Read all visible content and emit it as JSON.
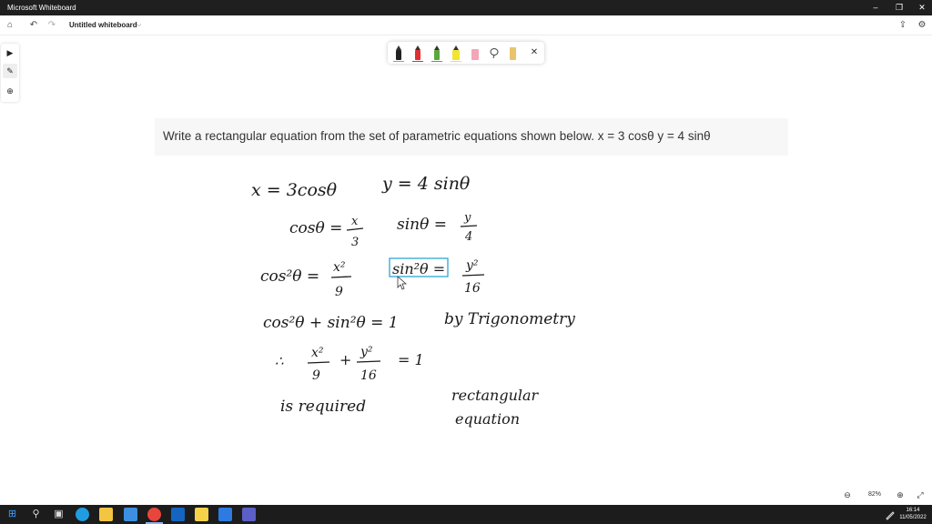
{
  "window": {
    "title": "Microsoft Whiteboard",
    "controls": [
      "–",
      "❐",
      "✕"
    ]
  },
  "appbar": {
    "document_title": "Untitled whiteboard",
    "chevron": "⌵"
  },
  "rail": {
    "tools": [
      "select-tool",
      "ink-tool",
      "add-tool"
    ]
  },
  "pen_toolbar": {
    "pens": [
      {
        "name": "black-pen",
        "color": "#222222"
      },
      {
        "name": "red-pen",
        "color": "#e03030"
      },
      {
        "name": "green-pen",
        "color": "#5aa83a"
      },
      {
        "name": "yellow-highlighter",
        "color": "#f2e531"
      },
      {
        "name": "pink-highlighter",
        "color": "#f2a6b6"
      }
    ],
    "close": "✕"
  },
  "question": {
    "text": "Write a rectangular equation from the set of parametric equations shown below. x = 3 cosθ y = 4 sinθ"
  },
  "handwriting": {
    "line1_left": "x = 3cosθ",
    "line1_right": "y = 4 sinθ",
    "line2_left_num": "cosθ = ",
    "line2_left_frac_num": "x",
    "line2_left_frac_den": "3",
    "line2_right_num": "sinθ = ",
    "line2_right_frac_num": "y",
    "line2_right_frac_den": "4",
    "line3_left": "cos²θ =",
    "line3_left_frac_num": "x²",
    "line3_left_frac_den": "9",
    "line3_right": "sin²θ =",
    "line3_right_frac_num": "y²",
    "line3_right_frac_den": "16",
    "line4_left": "cos²θ + sin²θ = 1",
    "line4_right": "by Trigonometry",
    "line5_therefore": "∴",
    "line5_frac1_num": "x²",
    "line5_frac1_den": "9",
    "line5_plus": "+",
    "line5_frac2_num": "y²",
    "line5_frac2_den": "16",
    "line5_eq": "= 1",
    "line6_left": "is required",
    "line6_right_a": "rectangular",
    "line6_right_b": "equation"
  },
  "zoom": {
    "level": "82%",
    "out": "⊖",
    "in": "⊕"
  },
  "taskbar": {
    "time": "16:14",
    "date": "11/05/2022",
    "apps": [
      {
        "name": "start-icon",
        "color": "#3aa0ff"
      },
      {
        "name": "search-icon",
        "color": "#dddddd"
      },
      {
        "name": "task-view-icon",
        "color": "#dddddd"
      },
      {
        "name": "edge-icon",
        "color": "#1f9de0"
      },
      {
        "name": "file-explorer-icon",
        "color": "#f4c542"
      },
      {
        "name": "store-icon",
        "color": "#3d8fe0"
      },
      {
        "name": "chrome-icon",
        "color": "#e8453c"
      },
      {
        "name": "outlook-icon",
        "color": "#1565c0"
      },
      {
        "name": "sticky-notes-icon",
        "color": "#f6d24a"
      },
      {
        "name": "mail-icon",
        "color": "#2d7be0"
      },
      {
        "name": "teams-icon",
        "color": "#5b5fc7"
      }
    ]
  }
}
